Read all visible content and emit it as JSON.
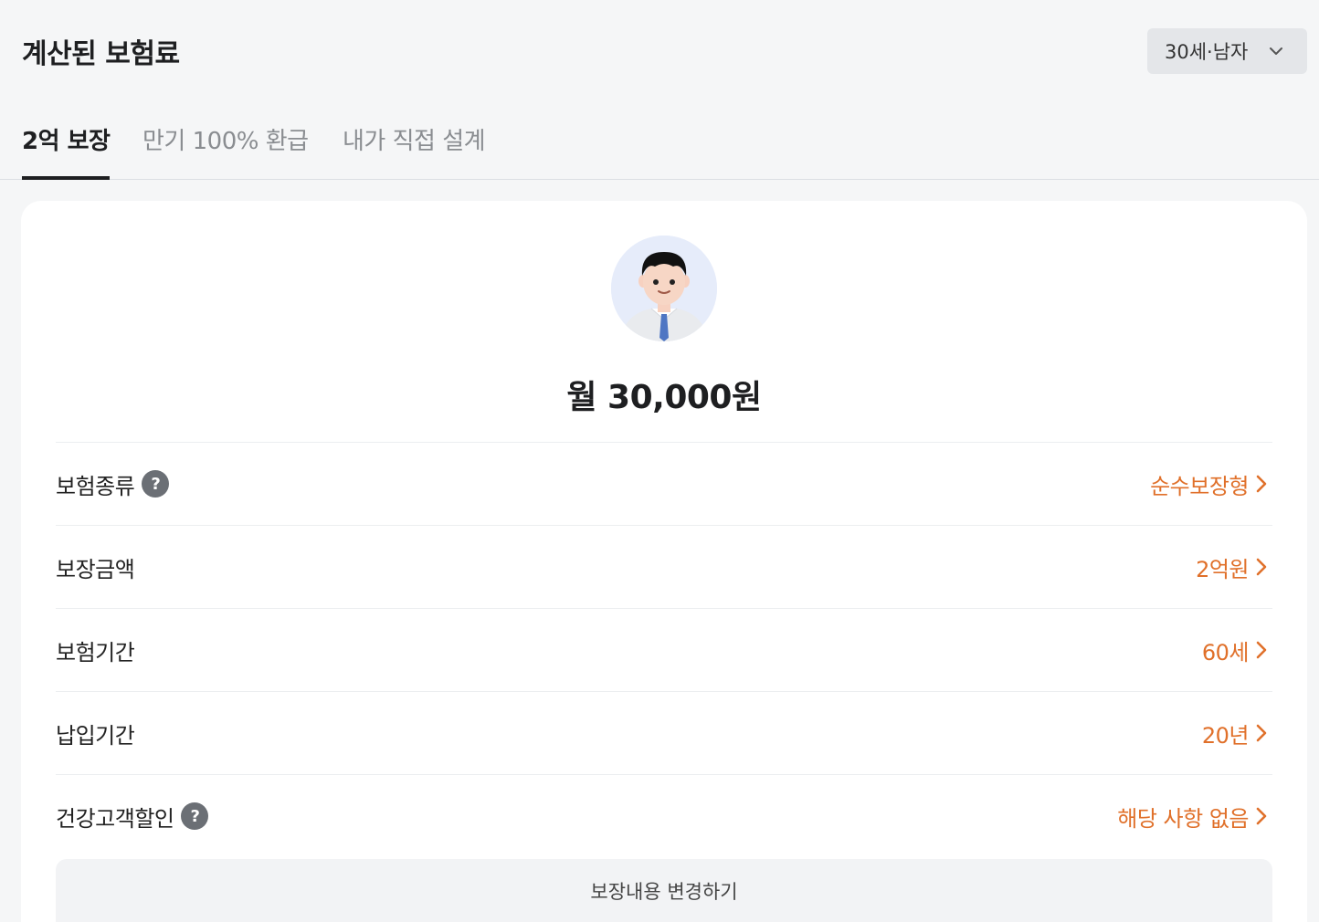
{
  "header": {
    "title": "계산된 보험료",
    "profile_select": {
      "value": "30세·남자",
      "icon": "chevron-down-icon"
    }
  },
  "tabs": [
    {
      "label": "2억 보장",
      "active": true
    },
    {
      "label": "만기 100% 환급",
      "active": false
    },
    {
      "label": "내가 직접 설계",
      "active": false
    }
  ],
  "summary": {
    "avatar": "man-avatar",
    "premium": "월 30,000원"
  },
  "rows": [
    {
      "label": "보험종류",
      "help": "?",
      "value": "순수보장형"
    },
    {
      "label": "보장금액",
      "value": "2억원"
    },
    {
      "label": "보험기간",
      "value": "60세"
    },
    {
      "label": "납입기간",
      "value": "20년"
    },
    {
      "label": "건강고객할인",
      "help": "?",
      "value": "해당 사항 없음"
    }
  ],
  "actions": {
    "change_label": "보장내용 변경하기"
  },
  "colors": {
    "accent": "#e0702a",
    "text": "#1e1f21",
    "background": "#f5f6f7"
  }
}
